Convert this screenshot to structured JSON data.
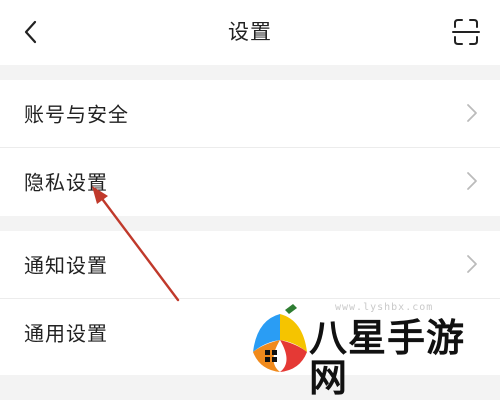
{
  "header": {
    "title": "设置",
    "back_icon": "chevron-left-icon",
    "scan_icon": "scan-icon"
  },
  "settings": {
    "group1": [
      {
        "label": "账号与安全"
      },
      {
        "label": "隐私设置"
      }
    ],
    "group2": [
      {
        "label": "通知设置"
      },
      {
        "label": "通用设置"
      }
    ]
  },
  "annotation": {
    "color": "#c0392b"
  },
  "watermark": {
    "url": "www.lyshbx.com",
    "text": "八星手游网"
  },
  "colors": {
    "background": "#f3f3f3",
    "surface": "#ffffff",
    "text": "#222222",
    "chevron": "#bbbbbb"
  }
}
